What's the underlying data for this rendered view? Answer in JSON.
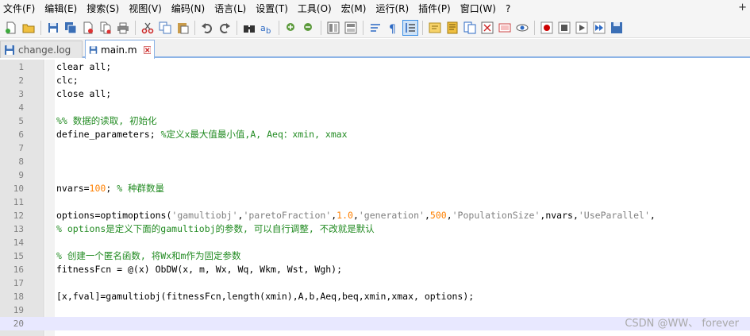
{
  "menu": [
    "文件(F)",
    "编辑(E)",
    "搜索(S)",
    "视图(V)",
    "编码(N)",
    "语言(L)",
    "设置(T)",
    "工具(O)",
    "宏(M)",
    "运行(R)",
    "插件(P)",
    "窗口(W)",
    "?"
  ],
  "menu_plus": "+",
  "toolbar_icons": [
    "new-file-icon",
    "open-file-icon",
    "save-icon",
    "save-all-icon",
    "close-icon",
    "close-all-icon",
    "print-icon",
    "cut-icon",
    "copy-icon",
    "paste-icon",
    "undo-icon",
    "redo-icon",
    "find-icon",
    "replace-icon",
    "zoom-in-icon",
    "zoom-out-icon",
    "sync-vertical-icon",
    "sync-horizontal-icon",
    "word-wrap-icon",
    "show-all-chars-icon",
    "indent-guide-icon",
    "user-language-icon",
    "doc-map-icon",
    "function-list-icon",
    "folder-workspace-icon",
    "monitor-icon",
    "eye-icon",
    "record-macro-icon",
    "stop-record-icon",
    "play-macro-icon",
    "run-macro-multiple-icon",
    "save-macro-icon"
  ],
  "tabs": [
    {
      "label": "change.log",
      "active": false
    },
    {
      "label": "main.m",
      "active": true
    }
  ],
  "lines": [
    [
      {
        "t": "clear all;",
        "c": "plain"
      }
    ],
    [
      {
        "t": "clc;",
        "c": "plain"
      }
    ],
    [
      {
        "t": "close all;",
        "c": "plain"
      }
    ],
    [],
    [
      {
        "t": "%% 数据的读取, 初始化",
        "c": "com"
      }
    ],
    [
      {
        "t": "define_parameters; ",
        "c": "plain"
      },
      {
        "t": "%定义x最大值最小值,A, Aeq：xmin, xmax",
        "c": "com"
      }
    ],
    [],
    [],
    [],
    [
      {
        "t": "nvars=",
        "c": "plain"
      },
      {
        "t": "100",
        "c": "num"
      },
      {
        "t": "; ",
        "c": "plain"
      },
      {
        "t": "% 种群数量",
        "c": "com"
      }
    ],
    [],
    [
      {
        "t": "options=optimoptions(",
        "c": "plain"
      },
      {
        "t": "'gamultiobj'",
        "c": "str"
      },
      {
        "t": ",",
        "c": "plain"
      },
      {
        "t": "'paretoFraction'",
        "c": "str"
      },
      {
        "t": ",",
        "c": "plain"
      },
      {
        "t": "1.0",
        "c": "num"
      },
      {
        "t": ",",
        "c": "plain"
      },
      {
        "t": "'generation'",
        "c": "str"
      },
      {
        "t": ",",
        "c": "plain"
      },
      {
        "t": "500",
        "c": "num"
      },
      {
        "t": ",",
        "c": "plain"
      },
      {
        "t": "'PopulationSize'",
        "c": "str"
      },
      {
        "t": ",nvars,",
        "c": "plain"
      },
      {
        "t": "'UseParallel'",
        "c": "str"
      },
      {
        "t": ",",
        "c": "plain"
      }
    ],
    [
      {
        "t": "% options是定义下面的gamultiobj的参数, 可以自行调整, 不改就是默认",
        "c": "com"
      }
    ],
    [],
    [
      {
        "t": "% 创建一个匿名函数, 将Wx和m作为固定参数",
        "c": "com"
      }
    ],
    [
      {
        "t": "fitnessFcn = @(x) ObDW(x, m, Wx, Wq, Wkm, Wst, Wgh);",
        "c": "plain"
      }
    ],
    [],
    [
      {
        "t": "[x,fval]=gamultiobj(fitnessFcn,length(xmin),A,b,Aeq,beq,xmin,xmax, options);",
        "c": "plain"
      }
    ],
    [],
    []
  ],
  "line_numbers": [
    "1",
    "2",
    "3",
    "4",
    "5",
    "6",
    "7",
    "8",
    "9",
    "10",
    "11",
    "12",
    "13",
    "14",
    "15",
    "16",
    "17",
    "18",
    "19",
    "20"
  ],
  "current_line": 20,
  "watermark": "CSDN @WW、 forever",
  "colors": {
    "comment": "#228b22",
    "number": "#ff8000",
    "string": "#808080",
    "current_line_bg": "#e8e8ff",
    "tab_accent": "#8db4e6"
  }
}
